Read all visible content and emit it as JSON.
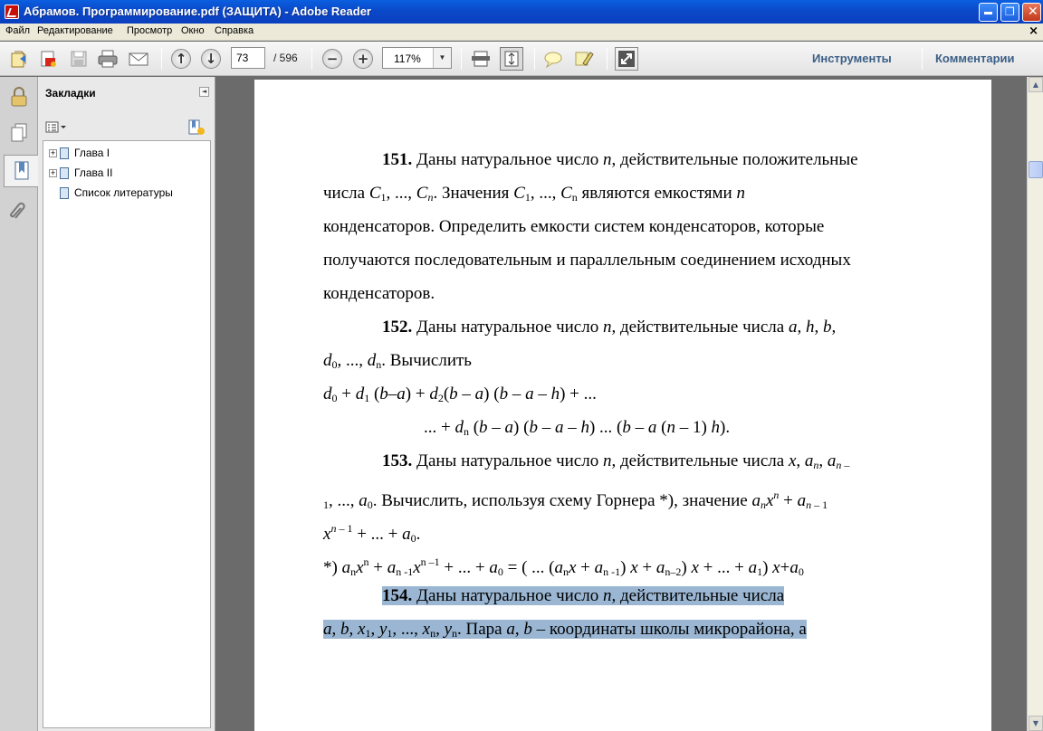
{
  "window": {
    "title": "Абрамов. Программирование.pdf (ЗАЩИТА) - Adobe Reader"
  },
  "menu": [
    "Файл",
    "Редактирование",
    "Просмотр",
    "Окно",
    "Справка"
  ],
  "toolbar": {
    "page_current": "73",
    "page_total": "/ 596",
    "zoom": "117%",
    "tools_label": "Инструменты",
    "comments_label": "Комментарии"
  },
  "bookmarks": {
    "header": "Закладки",
    "items": [
      {
        "label": "Глава I",
        "expandable": true
      },
      {
        "label": "Глава II",
        "expandable": true
      },
      {
        "label": "Список литературы",
        "expandable": false
      }
    ]
  },
  "document": {
    "p151": {
      "num": "151.",
      "l1": " Даны натуральное число ",
      "l1b": ", действительные положительные",
      "l2a": "числа ",
      "l2b": ". Значения ",
      "l2c": " являются емкостями ",
      "l3": "конденсаторов. Определить емкости систем конденсаторов, которые",
      "l4": "получаются последовательным и параллельным соединением исходных",
      "l5": "конденсаторов."
    },
    "p152": {
      "num": "152.",
      "l1": " Даны натуральное число ",
      "l1b": ", действительные числа ",
      "l2": ". Вычислить"
    },
    "p153": {
      "num": "153.",
      "l1": " Даны натуральное число ",
      "l1b": ", действительные числа ",
      "l2a": ". Вычислить, используя схему Горнера *), значение "
    },
    "p154": {
      "num": "154.",
      "l1": " Даны натуральное число ",
      "l1b": ", действительные числа",
      "l2": " – координаты школы микрорайона, а",
      "l2pre": ". Пара "
    }
  }
}
